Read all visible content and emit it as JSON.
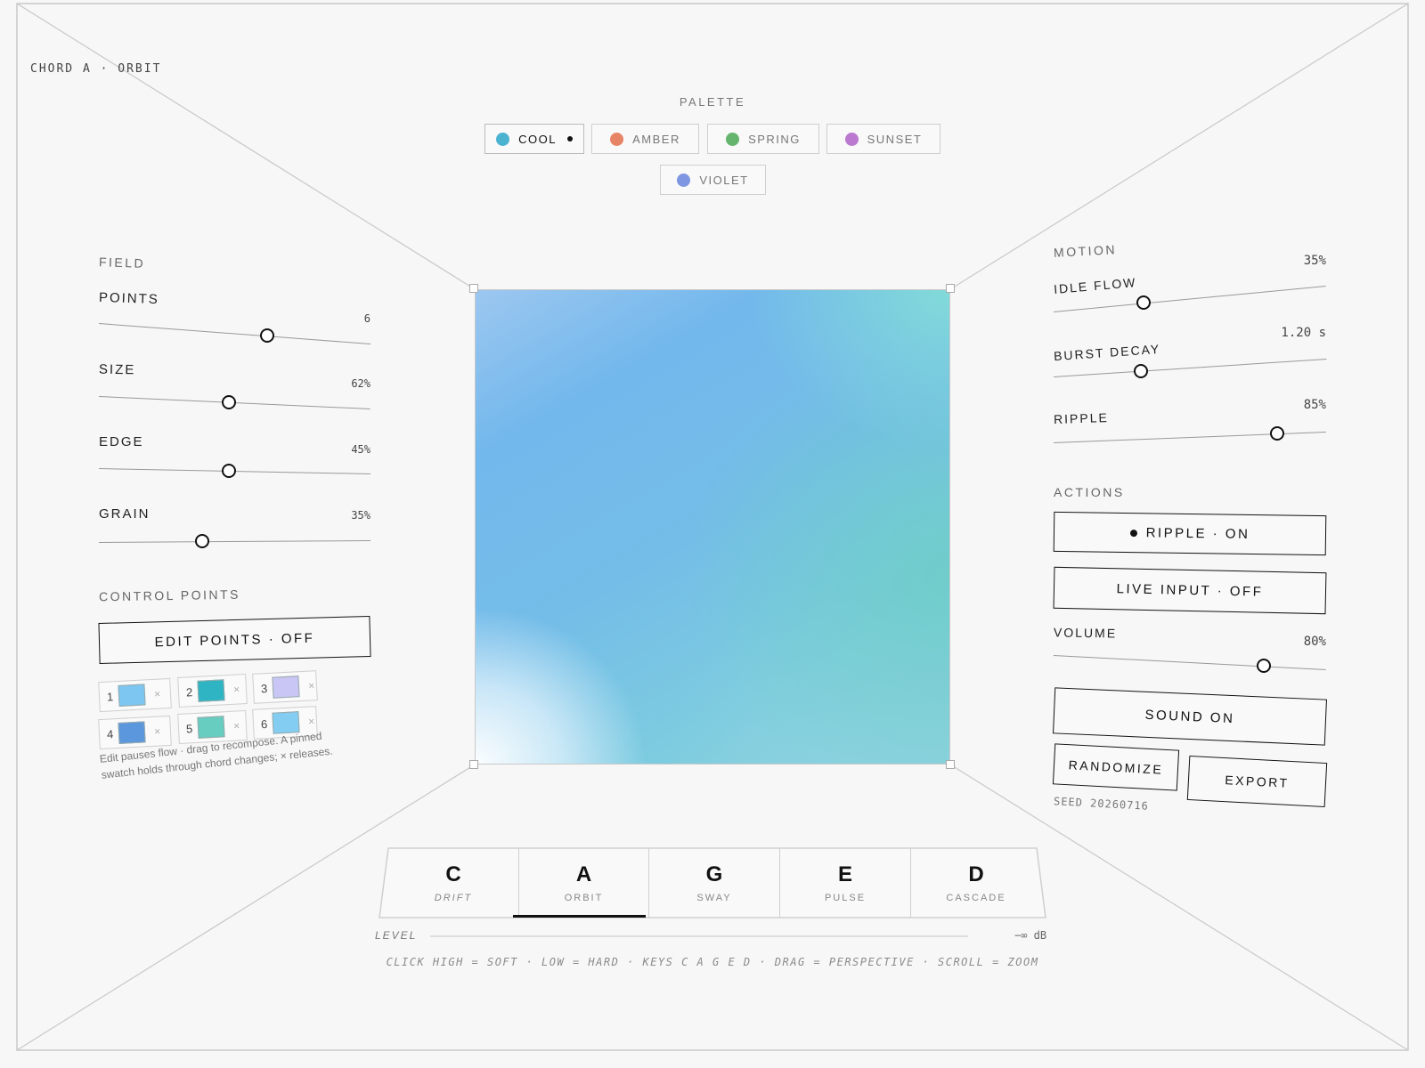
{
  "header": {
    "chord_label": "CHORD A · ORBIT"
  },
  "palette": {
    "title": "PALETTE",
    "options": [
      {
        "label": "COOL",
        "color": "#4bb2cf",
        "selected": true
      },
      {
        "label": "AMBER",
        "color": "#e88466",
        "selected": false
      },
      {
        "label": "SPRING",
        "color": "#66b56f",
        "selected": false
      },
      {
        "label": "SUNSET",
        "color": "#bb79cf",
        "selected": false
      },
      {
        "label": "VIOLET",
        "color": "#7f96e2",
        "selected": false
      }
    ]
  },
  "field": {
    "title": "FIELD",
    "sliders": [
      {
        "label": "POINTS",
        "value": "6",
        "level": 0.62
      },
      {
        "label": "SIZE",
        "value": "62%",
        "level": 0.48
      },
      {
        "label": "EDGE",
        "value": "45%",
        "level": 0.48
      },
      {
        "label": "GRAIN",
        "value": "35%",
        "level": 0.38
      }
    ]
  },
  "control_points": {
    "title": "CONTROL POINTS",
    "edit_button": "EDIT POINTS · OFF",
    "points": [
      {
        "num": "1",
        "color": "#7dc6f1"
      },
      {
        "num": "2",
        "color": "#2fb4c4"
      },
      {
        "num": "3",
        "color": "#c9c6f6"
      },
      {
        "num": "4",
        "color": "#5b97dc"
      },
      {
        "num": "5",
        "color": "#66cdc0"
      },
      {
        "num": "6",
        "color": "#84cdf2"
      }
    ],
    "remove_glyph": "×",
    "help_line1": "Edit pauses flow · drag to recompose. A pinned",
    "help_line2": "swatch holds through chord changes; × releases."
  },
  "motion": {
    "title": "MOTION",
    "sliders": [
      {
        "label": "IDLE FLOW",
        "value": "35%",
        "level": 0.33
      },
      {
        "label": "BURST DECAY",
        "value": "1.20 s",
        "level": 0.32
      },
      {
        "label": "RIPPLE",
        "value": "85%",
        "level": 0.82
      }
    ]
  },
  "actions": {
    "title": "ACTIONS",
    "ripple_button": "RIPPLE · ON",
    "live_input_button": "LIVE INPUT · OFF",
    "volume": {
      "label": "VOLUME",
      "value": "80%",
      "level": 0.77
    },
    "sound_button": "SOUND ON",
    "randomize_button": "RANDOMIZE",
    "export_button": "EXPORT",
    "seed": "SEED 20260716"
  },
  "chords": [
    {
      "letter": "C",
      "mode": "DRIFT",
      "active": false
    },
    {
      "letter": "A",
      "mode": "ORBIT",
      "active": true
    },
    {
      "letter": "G",
      "mode": "SWAY",
      "active": false
    },
    {
      "letter": "E",
      "mode": "PULSE",
      "active": false
    },
    {
      "letter": "D",
      "mode": "CASCADE",
      "active": false
    }
  ],
  "level": {
    "label": "LEVEL",
    "value": "−∞ dB",
    "level": 0
  },
  "hint": "CLICK HIGH = SOFT · LOW = HARD · KEYS C A G E D · DRAG = PERSPECTIVE · SCROLL = ZOOM",
  "colors": {
    "accent": "#111111",
    "frame": "#c8c8c8",
    "background": "#f7f7f7"
  }
}
